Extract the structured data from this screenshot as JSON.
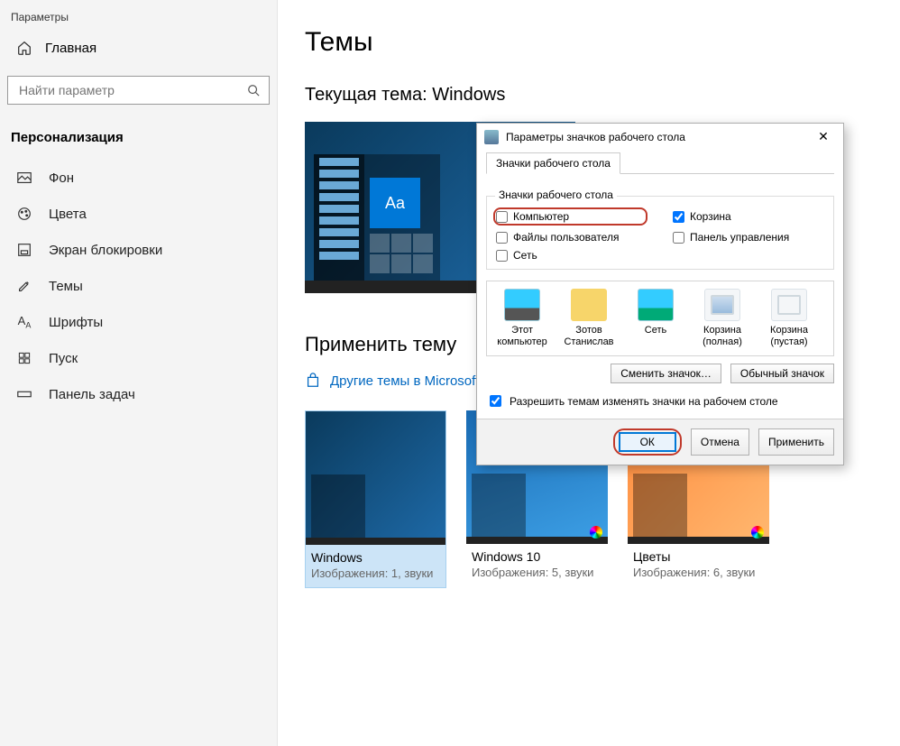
{
  "app": {
    "title": "Параметры"
  },
  "home": {
    "label": "Главная"
  },
  "search": {
    "placeholder": "Найти параметр"
  },
  "section": {
    "title": "Персонализация"
  },
  "nav": [
    {
      "label": "Фон"
    },
    {
      "label": "Цвета"
    },
    {
      "label": "Экран блокировки"
    },
    {
      "label": "Темы"
    },
    {
      "label": "Шрифты"
    },
    {
      "label": "Пуск"
    },
    {
      "label": "Панель задач"
    }
  ],
  "page": {
    "title": "Темы",
    "current_theme_label": "Текущая тема: Windows",
    "apply_title": "Применить тему",
    "store_link": "Другие темы в Microsoft S"
  },
  "preview": {
    "tile_text": "Aa"
  },
  "themes": [
    {
      "name": "Windows",
      "meta": "Изображения: 1, звуки",
      "selected": true,
      "chip": false
    },
    {
      "name": "Windows 10",
      "meta": "Изображения: 5, звуки",
      "selected": false,
      "chip": true
    },
    {
      "name": "Цветы",
      "meta": "Изображения: 6, звуки",
      "selected": false,
      "chip": true
    }
  ],
  "dialog": {
    "title": "Параметры значков рабочего стола",
    "tab": "Значки рабочего стола",
    "group_label": "Значки рабочего стола",
    "checks": {
      "computer": {
        "label": "Компьютер",
        "checked": false
      },
      "recycle": {
        "label": "Корзина",
        "checked": true
      },
      "userfiles": {
        "label": "Файлы пользователя",
        "checked": false
      },
      "cpanel": {
        "label": "Панель управления",
        "checked": false
      },
      "network": {
        "label": "Сеть",
        "checked": false
      }
    },
    "icons": [
      {
        "label": "Этот\nкомпьютер",
        "kind": "pc"
      },
      {
        "label": "Зотов\nСтанислав",
        "kind": "user"
      },
      {
        "label": "Сеть",
        "kind": "net"
      },
      {
        "label": "Корзина\n(полная)",
        "kind": "binfull"
      },
      {
        "label": "Корзина\n(пустая)",
        "kind": "bin"
      }
    ],
    "change_icon_btn": "Сменить значок…",
    "default_icon_btn": "Обычный значок",
    "allow_themes_label": "Разрешить темам изменять значки на рабочем столе",
    "allow_themes_checked": true,
    "ok": "ОК",
    "cancel": "Отмена",
    "apply": "Применить"
  }
}
